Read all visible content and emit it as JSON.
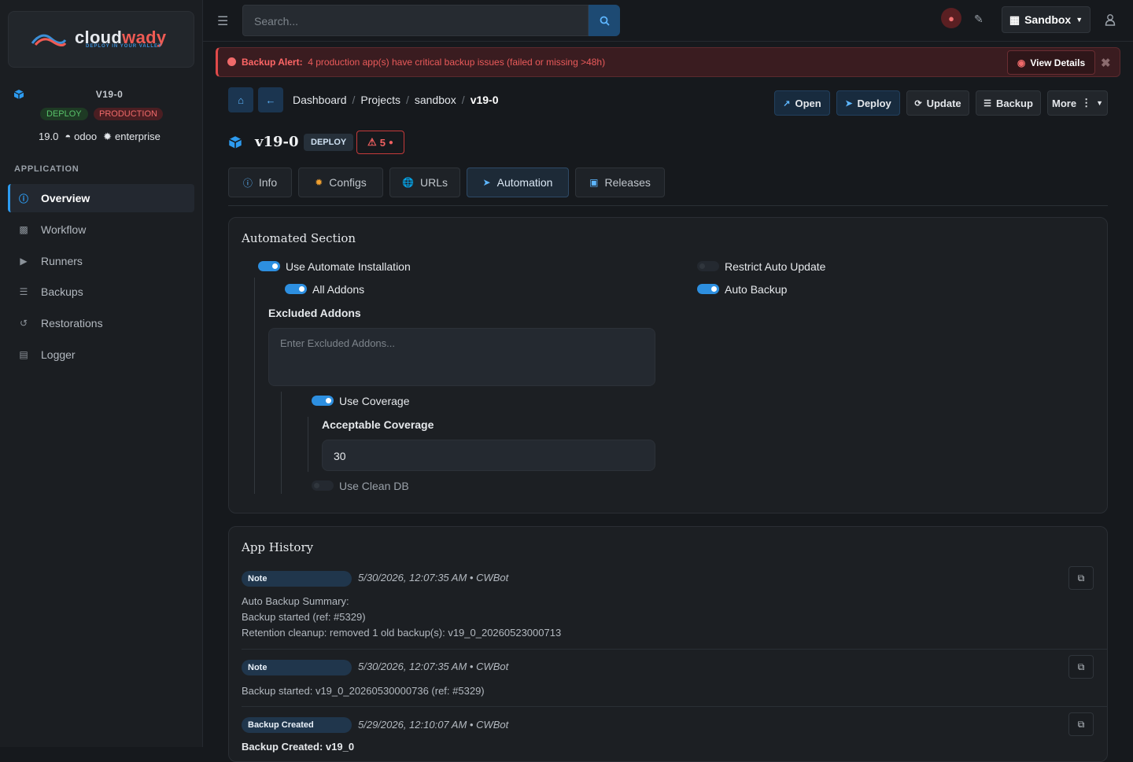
{
  "brand": {
    "name_part1": "cloud",
    "name_part2": "wady",
    "tagline": "DEPLOY IN YOUR VALLEY"
  },
  "app": {
    "name": "V19-0",
    "badge_deploy": "DEPLOY",
    "badge_env": "PRODUCTION",
    "version": "19.0",
    "platform": "odoo",
    "edition": "enterprise"
  },
  "sidebar": {
    "section_label": "APPLICATION",
    "items": [
      {
        "label": "Overview",
        "icon": "info-icon"
      },
      {
        "label": "Workflow",
        "icon": "sitemap-icon"
      },
      {
        "label": "Runners",
        "icon": "play-circle-icon"
      },
      {
        "label": "Backups",
        "icon": "database-icon"
      },
      {
        "label": "Restorations",
        "icon": "history-icon"
      },
      {
        "label": "Logger",
        "icon": "file-icon"
      }
    ]
  },
  "topbar": {
    "search_placeholder": "Search...",
    "env_label": "Sandbox"
  },
  "alert": {
    "title": "Backup Alert:",
    "message": "4 production app(s) have critical backup issues (failed or missing >48h)",
    "button": "View Details"
  },
  "breadcrumb": [
    "Dashboard",
    "Projects",
    "sandbox",
    "v19-0"
  ],
  "actions": {
    "open": "Open",
    "deploy": "Deploy",
    "update": "Update",
    "backup": "Backup",
    "more": "More"
  },
  "header": {
    "title": "v19-0",
    "badge": "DEPLOY",
    "warning_count": "5"
  },
  "tabs": [
    "Info",
    "Configs",
    "URLs",
    "Automation",
    "Releases"
  ],
  "automation": {
    "title": "Automated Section",
    "use_automate_installation": "Use Automate Installation",
    "all_addons": "All Addons",
    "excluded_addons_label": "Excluded Addons",
    "excluded_addons_placeholder": "Enter Excluded Addons...",
    "use_coverage": "Use Coverage",
    "acceptable_coverage_label": "Acceptable Coverage",
    "acceptable_coverage_value": "30",
    "use_clean_db": "Use Clean DB",
    "restrict_auto_update": "Restrict Auto Update",
    "auto_backup": "Auto Backup",
    "toggles": {
      "use_automate_installation": true,
      "all_addons": true,
      "use_coverage": true,
      "use_clean_db": false,
      "restrict_auto_update": false,
      "auto_backup": true
    }
  },
  "history": {
    "title": "App History",
    "entries": [
      {
        "type": "Note",
        "meta": "5/30/2026, 12:07:35 AM • CWBot",
        "lines": [
          "Auto Backup Summary:",
          "Backup started (ref: #5329)",
          "Retention cleanup: removed 1 old backup(s): v19_0_20260523000713"
        ]
      },
      {
        "type": "Note",
        "meta": "5/30/2026, 12:07:35 AM • CWBot",
        "lines": [
          "Backup started: v19_0_20260530000736 (ref: #5329)"
        ]
      },
      {
        "type": "Backup Created",
        "meta": "5/29/2026, 12:10:07 AM • CWBot",
        "lines": [
          "Backup Created: v19_0"
        ]
      }
    ]
  },
  "colors": {
    "accent": "#2d9bf0",
    "danger": "#e04a4a",
    "success": "#59c36a",
    "background": "#16191d"
  }
}
